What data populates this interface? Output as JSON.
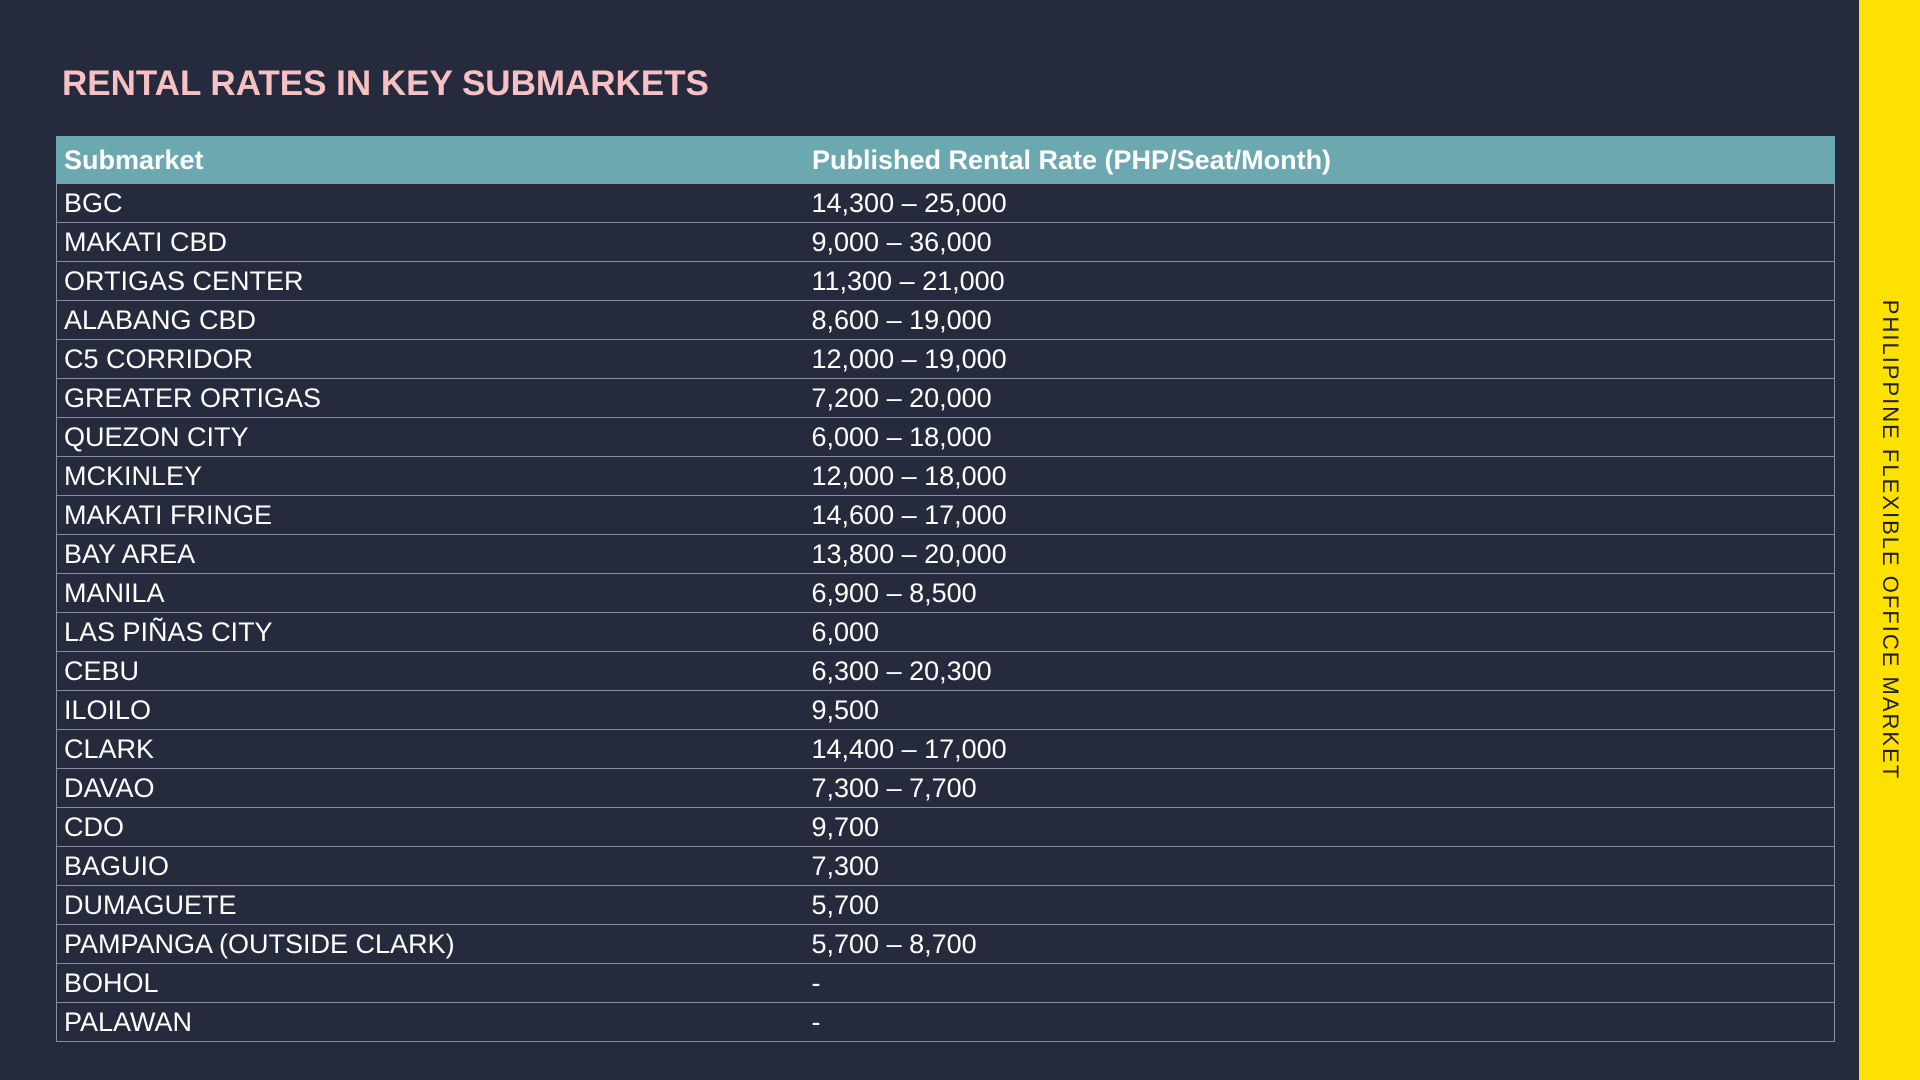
{
  "title": "RENTAL RATES IN KEY SUBMARKETS",
  "side_label": "PHILIPPINE FLEXIBLE OFFICE MARKET",
  "colors": {
    "background": "#262a3d",
    "title": "#f7c1c4",
    "header_fill": "#6ba8b0",
    "side_band": "#ffe100"
  },
  "table": {
    "headers": [
      "Submarket",
      "Published Rental Rate (PHP/Seat/Month)"
    ],
    "rows": [
      [
        "BGC",
        "14,300 – 25,000"
      ],
      [
        "MAKATI CBD",
        "9,000 – 36,000"
      ],
      [
        "ORTIGAS CENTER",
        "11,300 – 21,000"
      ],
      [
        "ALABANG CBD",
        "8,600 – 19,000"
      ],
      [
        "C5 CORRIDOR",
        "12,000 – 19,000"
      ],
      [
        "GREATER ORTIGAS",
        "7,200 – 20,000"
      ],
      [
        "QUEZON CITY",
        "6,000 – 18,000"
      ],
      [
        "MCKINLEY",
        "12,000 – 18,000"
      ],
      [
        "MAKATI FRINGE",
        "14,600 – 17,000"
      ],
      [
        "BAY AREA",
        "13,800 – 20,000"
      ],
      [
        "MANILA",
        "6,900 – 8,500"
      ],
      [
        "LAS PIÑAS CITY",
        "6,000"
      ],
      [
        "CEBU",
        "6,300 – 20,300"
      ],
      [
        "ILOILO",
        "9,500"
      ],
      [
        "CLARK",
        "14,400 – 17,000"
      ],
      [
        "DAVAO",
        "7,300 – 7,700"
      ],
      [
        "CDO",
        "9,700"
      ],
      [
        "BAGUIO",
        "7,300"
      ],
      [
        "DUMAGUETE",
        "5,700"
      ],
      [
        "PAMPANGA (OUTSIDE CLARK)",
        "5,700 – 8,700"
      ],
      [
        "BOHOL",
        "-"
      ],
      [
        "PALAWAN",
        "-"
      ]
    ]
  }
}
